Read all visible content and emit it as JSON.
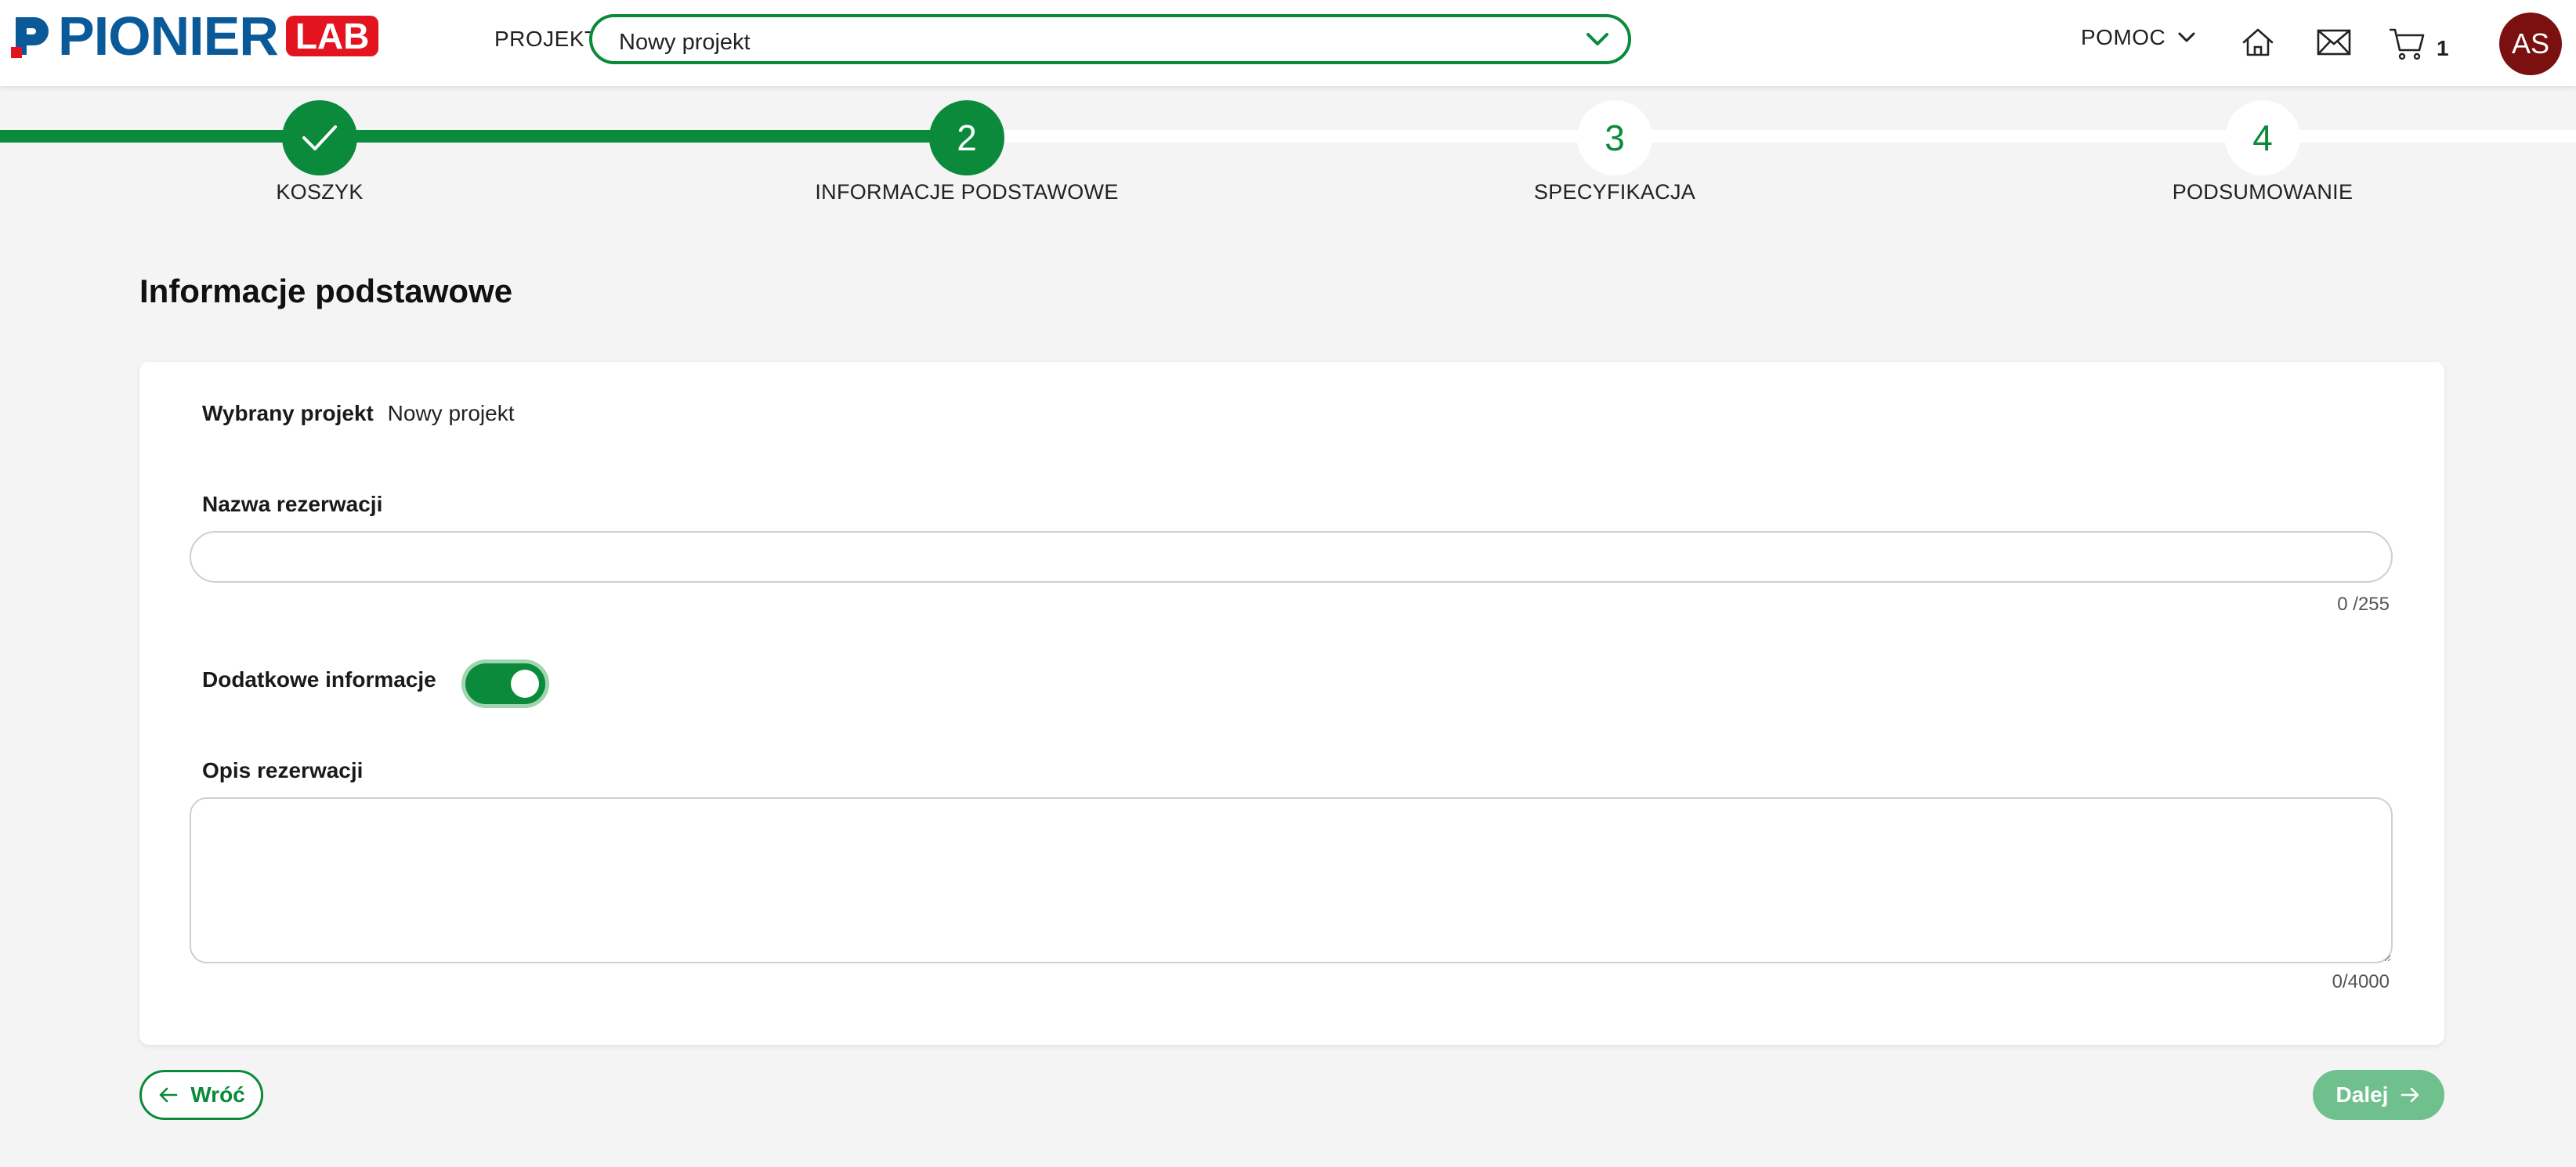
{
  "header": {
    "logo_text": "PIONIER",
    "logo_badge": "LAB",
    "project_label": "PROJEKT",
    "project_selected": "Nowy projekt",
    "help_label": "POMOC",
    "cart_count": "1",
    "avatar_initials": "AS",
    "icons": [
      "home-icon",
      "mail-icon",
      "cart-icon",
      "chevron-down-icon"
    ]
  },
  "stepper": {
    "current_step": 2,
    "steps": [
      {
        "number": "1",
        "label": "KOSZYK",
        "state": "done"
      },
      {
        "number": "2",
        "label": "INFORMACJE PODSTAWOWE",
        "state": "active"
      },
      {
        "number": "3",
        "label": "SPECYFIKACJA",
        "state": "todo"
      },
      {
        "number": "4",
        "label": "PODSUMOWANIE",
        "state": "todo"
      }
    ]
  },
  "page": {
    "title": "Informacje podstawowe",
    "selected_project_label": "Wybrany projekt",
    "selected_project_value": "Nowy projekt",
    "reservation_name_label": "Nazwa rezerwacji",
    "reservation_name_value": "",
    "reservation_name_counter": "0 /255",
    "additional_info_label": "Dodatkowe informacje",
    "additional_info_enabled": true,
    "description_label": "Opis rezerwacji",
    "description_value": "",
    "description_counter": "0/4000"
  },
  "buttons": {
    "back_label": "Wróć",
    "next_label": "Dalej"
  },
  "colors": {
    "primary_green": "#0a8a3a",
    "disabled_green": "#6fc08c",
    "logo_blue": "#0a5a99",
    "logo_red": "#e3141f",
    "avatar_bg": "#7a1010"
  }
}
